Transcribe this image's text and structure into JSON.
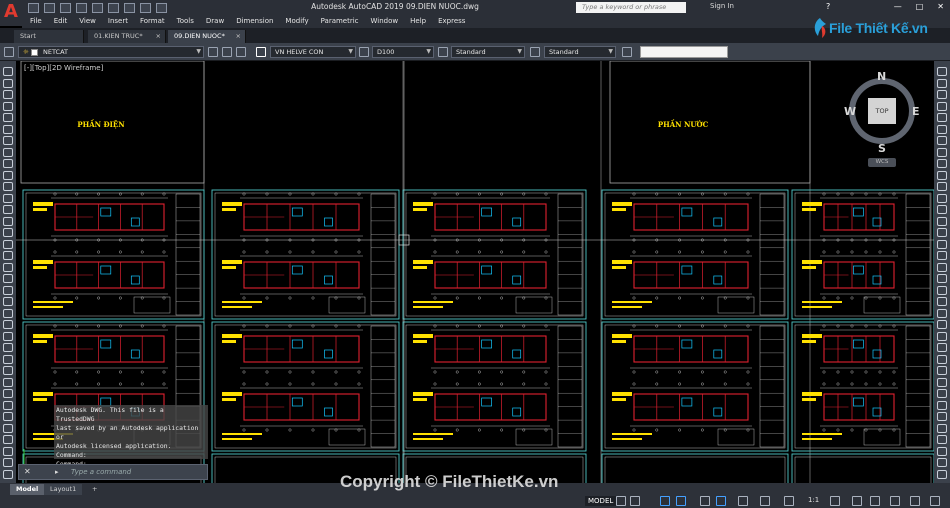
{
  "app": {
    "window_title": "Autodesk AutoCAD 2019   09.DIEN NUOC.dwg",
    "search_placeholder": "Type a keyword or phrase",
    "sign_in": "Sign In",
    "help": "?",
    "window_controls": [
      "—",
      "□",
      "✕"
    ]
  },
  "menu": [
    "File",
    "Edit",
    "View",
    "Insert",
    "Format",
    "Tools",
    "Draw",
    "Dimension",
    "Modify",
    "Parametric",
    "Window",
    "Help",
    "Express"
  ],
  "tabs": [
    {
      "label": "Start"
    },
    {
      "label": "01.KIEN TRUC*"
    },
    {
      "label": "09.DIEN NUOC*"
    }
  ],
  "properties_toolbar": {
    "layer": "NETCAT",
    "text_style": "VN HELVE CON",
    "dim_style": "D100",
    "table_style": "Standard",
    "multileader_style": "Standard"
  },
  "viewport_label": "[-][Top][2D Wireframe]",
  "viewcube": {
    "north": "N",
    "south": "S",
    "east": "E",
    "west": "W",
    "top": "TOP",
    "wcs": "WCS"
  },
  "drawing": {
    "title_left": "PHẦN ĐIỆN",
    "title_right": "PHẦN NƯỚC"
  },
  "command_line": {
    "history": [
      "Autodesk DWG.  This file is a TrustedDWG",
      "last saved by an Autodesk application or",
      "Autodesk licensed application.",
      "Command:",
      "Command:"
    ],
    "placeholder": "Type a command",
    "close_icon": "✕"
  },
  "layout_tabs": [
    "Model",
    "Layout1",
    "+"
  ],
  "status_bar": {
    "model": "MODEL",
    "scale": "1:1"
  },
  "watermark": {
    "brand": "File Thiết Kế.vn",
    "copyright": "Copyright © FileThietKe.vn"
  },
  "colors": {
    "titlebar": "#2b2f37",
    "toolbar": "#3b414b",
    "canvas": "#000000",
    "sheet_border": "#4fc7c7",
    "walls": "#e02030",
    "text_yellow": "#ffe100",
    "cyan": "#14c8ff",
    "accent_logo": "#e03a2f",
    "brand_blue": "#2a9fd8"
  }
}
